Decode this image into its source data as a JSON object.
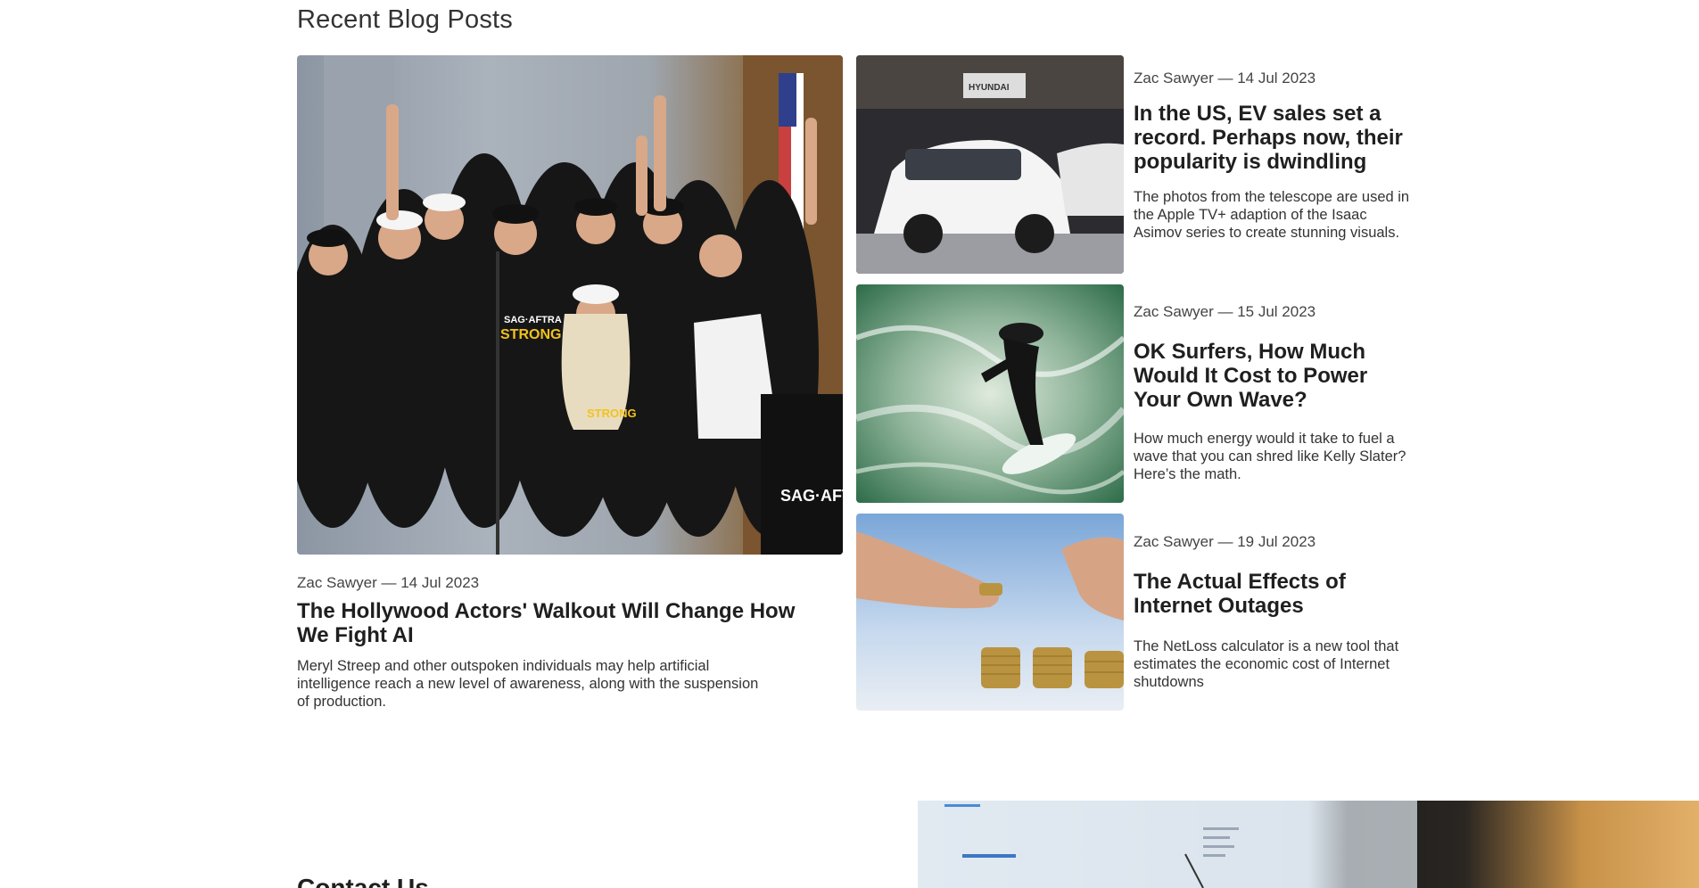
{
  "section": {
    "title": "Recent Blog Posts"
  },
  "featured": {
    "meta": "Zac Sawyer — 14 Jul 2023",
    "title": "The Hollywood Actors' Walkout Will Change How We Fight AI",
    "excerpt": "Meryl Streep and other outspoken individuals may help artificial intelligence reach a new level of awareness, along with the suspension of production.",
    "image": {
      "alt_desc": "rally-photo",
      "sign_text": "SAG·AFT",
      "shirt_text_top": "SAG·AFTRA",
      "shirt_text_bottom": "STRONG"
    }
  },
  "posts": [
    {
      "meta": "Zac Sawyer — 14 Jul 2023",
      "title": "In the US, EV sales set a record. Perhaps now, their popularity is dwindling",
      "excerpt": "The photos from the telescope are used in the Apple TV+ adaption of the Isaac Asimov series to create stunning visuals.",
      "image_text": "HYUNDAI"
    },
    {
      "meta": "Zac Sawyer — 15 Jul 2023",
      "title": "OK Surfers, How Much Would It Cost to Power Your Own Wave?",
      "excerpt": "How much energy would it take to fuel a wave that you can shred like Kelly Slater? Here’s the math."
    },
    {
      "meta": "Zac Sawyer — 19 Jul 2023",
      "title": "The Actual Effects of Internet Outages",
      "excerpt": "The NetLoss calculator is a new tool that estimates the economic cost of Internet shutdowns"
    }
  ],
  "contact": {
    "heading": "Contact Us"
  },
  "colors": {
    "text": "#1f1f1f",
    "muted": "#444444",
    "shirt_yellow": "#f2c21b"
  }
}
